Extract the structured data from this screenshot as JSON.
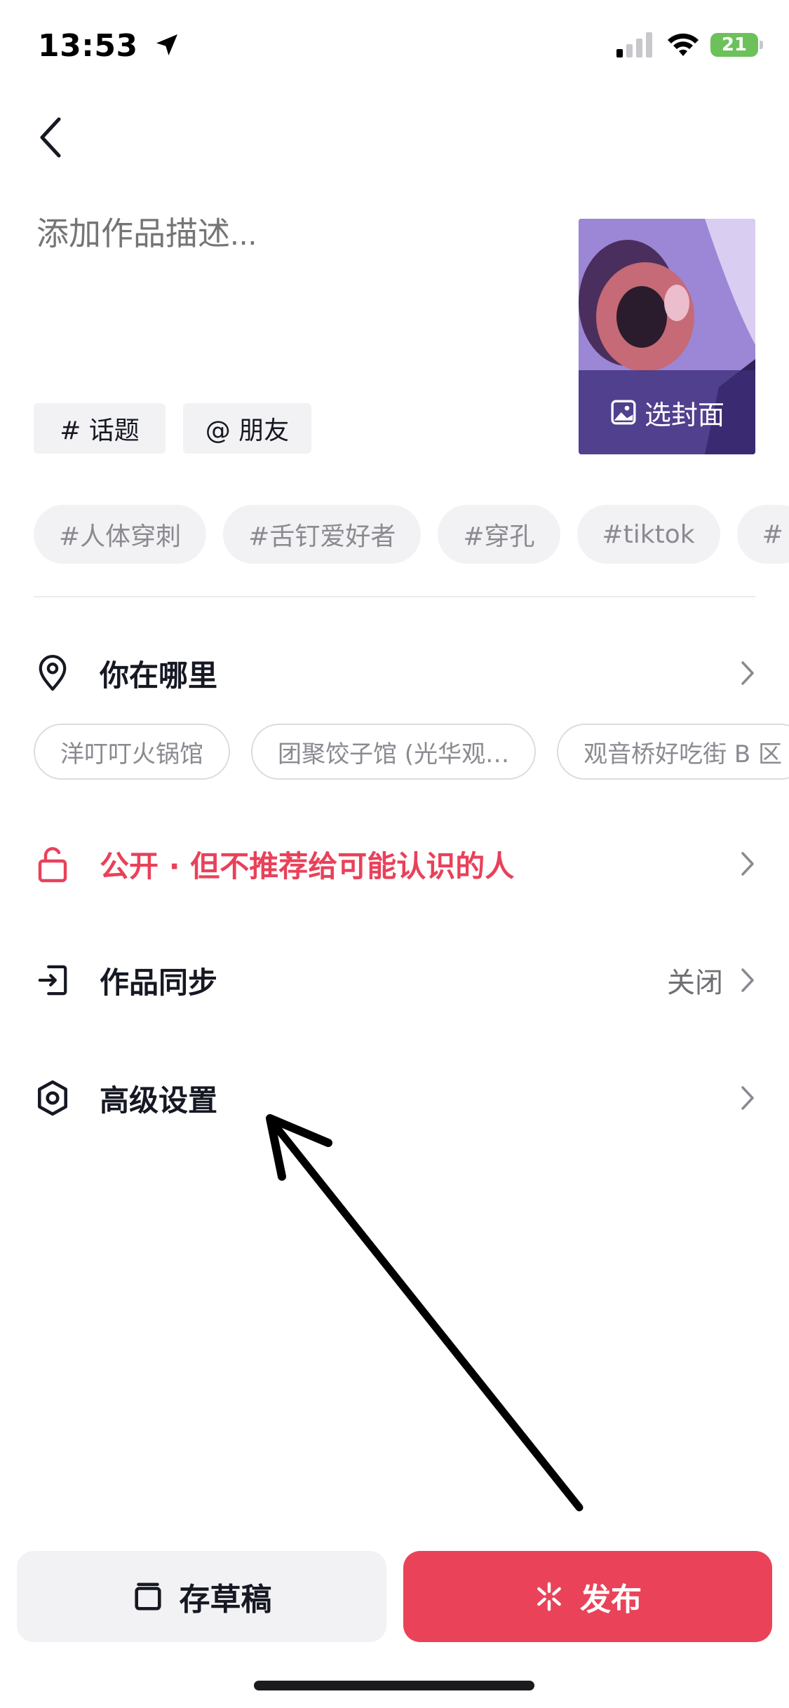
{
  "status_bar": {
    "time": "13:53",
    "battery": "21"
  },
  "description": {
    "placeholder": "添加作品描述..."
  },
  "quick_actions": {
    "topic": "# 话题",
    "friend": "@ 朋友"
  },
  "cover": {
    "label": "选封面"
  },
  "hashtags": [
    "#人体穿刺",
    "#舌钉爱好者",
    "#穿孔",
    "#tiktok",
    "#"
  ],
  "location": {
    "label": "你在哪里",
    "suggestions": [
      "洋叮叮火锅馆",
      "团聚饺子馆 (光华观…",
      "观音桥好吃街 B 区"
    ]
  },
  "privacy": {
    "label": "公开 · 但不推荐给可能认识的人",
    "color": "#e9415a"
  },
  "sync": {
    "label": "作品同步",
    "value": "关闭"
  },
  "advanced": {
    "label": "高级设置"
  },
  "bottom": {
    "draft_label": "存草稿",
    "publish_label": "发布",
    "publish_color": "#ea4359"
  }
}
